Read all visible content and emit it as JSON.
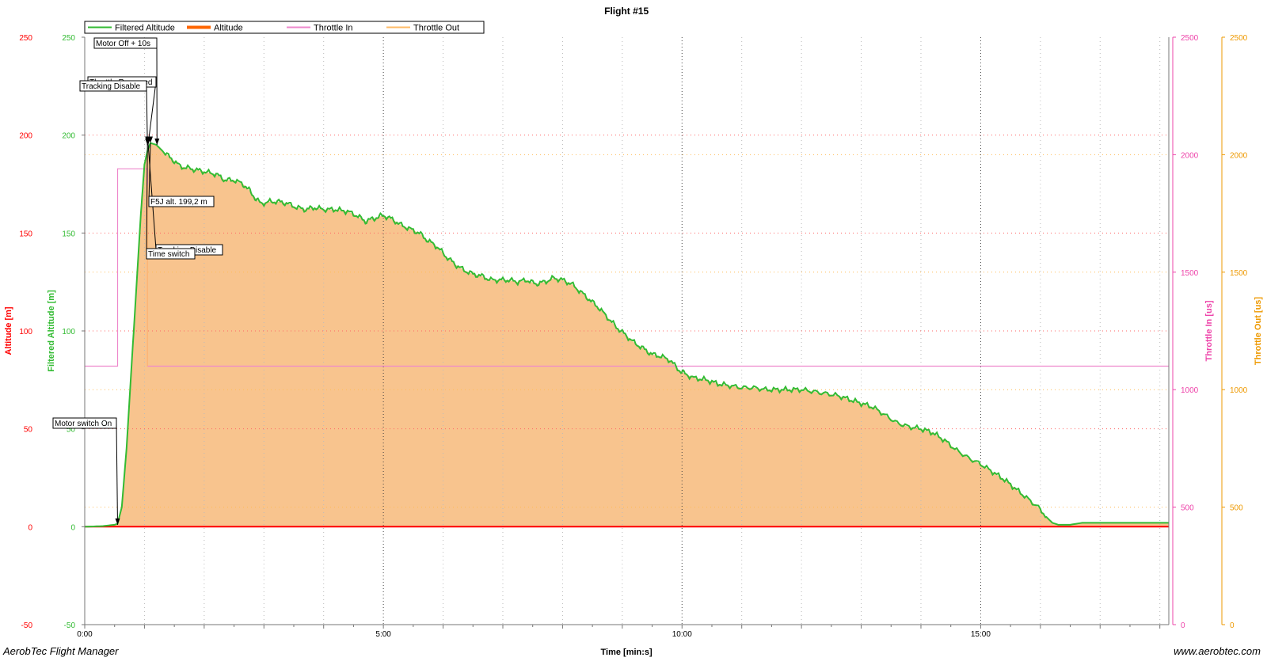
{
  "app": {
    "footer_left": "AerobTec Flight Manager",
    "footer_right": "www.aerobtec.com"
  },
  "chart_data": {
    "type": "line",
    "title": "Flight #15",
    "xlabel": "Time [min:s]",
    "x_unit": "minutes",
    "xlim": [
      0,
      18.15
    ],
    "x_ticks": [
      {
        "value": 0,
        "label": "0:00"
      },
      {
        "value": 5,
        "label": "5:00"
      },
      {
        "value": 10,
        "label": "10:00"
      },
      {
        "value": 15,
        "label": "15:00"
      }
    ],
    "axes": {
      "altitude": {
        "label": "Altitude [m]",
        "ylim": [
          -50,
          250
        ],
        "ticks": [
          -50,
          0,
          50,
          100,
          150,
          200,
          250
        ],
        "color": "#ff0000"
      },
      "filtered_altitude": {
        "label": "Filtered Altitude [m]",
        "ylim": [
          -50,
          250
        ],
        "ticks": [
          -50,
          0,
          50,
          100,
          150,
          200,
          250
        ],
        "color": "#33bb33"
      },
      "throttle_in": {
        "label": "Throttle In [us]",
        "ylim": [
          0,
          2500
        ],
        "ticks": [
          0,
          500,
          1000,
          1500,
          2000,
          2500
        ],
        "color": "#ee44aa"
      },
      "throttle_out": {
        "label": "Throttle Out [us]",
        "ylim": [
          0,
          2500
        ],
        "ticks": [
          0,
          500,
          1000,
          1500,
          2000,
          2500
        ],
        "color": "#ee9900"
      }
    },
    "grid": true,
    "legend_position": "top-left",
    "legend": [
      {
        "name": "Filtered Altitude",
        "color": "#33bb33"
      },
      {
        "name": "Altitude",
        "color": "#ff6600"
      },
      {
        "name": "Throttle In",
        "color": "#ee88cc"
      },
      {
        "name": "Throttle Out",
        "color": "#ffbb66"
      }
    ],
    "series": [
      {
        "name": "Filtered Altitude",
        "axis": "filtered_altitude",
        "color": "#33bb33",
        "fill": "#f8c48e",
        "points": [
          [
            0.0,
            0
          ],
          [
            0.3,
            0.3
          ],
          [
            0.5,
            1
          ],
          [
            0.55,
            1.5
          ],
          [
            0.62,
            10
          ],
          [
            0.7,
            40
          ],
          [
            0.78,
            80
          ],
          [
            0.86,
            120
          ],
          [
            0.94,
            160
          ],
          [
            1.0,
            185
          ],
          [
            1.05,
            192
          ],
          [
            1.1,
            196
          ],
          [
            1.2,
            195
          ],
          [
            1.3,
            192
          ],
          [
            1.45,
            188
          ],
          [
            1.6,
            184
          ],
          [
            1.75,
            183
          ],
          [
            1.9,
            182
          ],
          [
            2.05,
            181
          ],
          [
            2.2,
            180
          ],
          [
            2.35,
            177
          ],
          [
            2.5,
            177
          ],
          [
            2.65,
            175
          ],
          [
            2.75,
            172
          ],
          [
            2.85,
            168
          ],
          [
            2.95,
            165
          ],
          [
            3.1,
            166
          ],
          [
            3.25,
            166
          ],
          [
            3.4,
            165
          ],
          [
            3.55,
            163
          ],
          [
            3.7,
            162
          ],
          [
            3.85,
            163
          ],
          [
            4.0,
            162
          ],
          [
            4.2,
            162
          ],
          [
            4.4,
            161
          ],
          [
            4.55,
            159
          ],
          [
            4.7,
            156
          ],
          [
            4.8,
            157
          ],
          [
            4.9,
            158
          ],
          [
            5.0,
            159
          ],
          [
            5.15,
            157
          ],
          [
            5.3,
            154
          ],
          [
            5.45,
            152
          ],
          [
            5.6,
            150
          ],
          [
            5.75,
            146
          ],
          [
            5.9,
            143
          ],
          [
            6.05,
            138
          ],
          [
            6.2,
            134
          ],
          [
            6.35,
            131
          ],
          [
            6.5,
            129
          ],
          [
            6.65,
            128
          ],
          [
            6.8,
            126
          ],
          [
            6.95,
            126
          ],
          [
            7.1,
            126
          ],
          [
            7.25,
            125
          ],
          [
            7.4,
            126
          ],
          [
            7.55,
            124
          ],
          [
            7.7,
            125
          ],
          [
            7.85,
            127
          ],
          [
            8.0,
            126
          ],
          [
            8.15,
            124
          ],
          [
            8.3,
            120
          ],
          [
            8.45,
            116
          ],
          [
            8.6,
            112
          ],
          [
            8.75,
            107
          ],
          [
            8.9,
            102
          ],
          [
            9.05,
            98
          ],
          [
            9.2,
            94
          ],
          [
            9.35,
            91
          ],
          [
            9.5,
            88
          ],
          [
            9.65,
            87
          ],
          [
            9.8,
            85
          ],
          [
            9.95,
            80
          ],
          [
            10.05,
            78
          ],
          [
            10.2,
            76
          ],
          [
            10.4,
            75
          ],
          [
            10.6,
            73
          ],
          [
            10.8,
            72
          ],
          [
            11.0,
            71
          ],
          [
            11.2,
            71
          ],
          [
            11.4,
            70
          ],
          [
            11.6,
            70
          ],
          [
            11.8,
            70
          ],
          [
            12.0,
            70
          ],
          [
            12.2,
            69
          ],
          [
            12.4,
            68
          ],
          [
            12.6,
            67
          ],
          [
            12.8,
            65
          ],
          [
            13.0,
            63
          ],
          [
            13.2,
            61
          ],
          [
            13.4,
            57
          ],
          [
            13.6,
            53
          ],
          [
            13.8,
            51
          ],
          [
            14.0,
            50
          ],
          [
            14.2,
            48
          ],
          [
            14.4,
            44
          ],
          [
            14.6,
            39
          ],
          [
            14.8,
            35
          ],
          [
            15.0,
            32
          ],
          [
            15.2,
            28
          ],
          [
            15.4,
            24
          ],
          [
            15.6,
            19
          ],
          [
            15.8,
            14
          ],
          [
            16.0,
            9
          ],
          [
            16.1,
            5
          ],
          [
            16.2,
            2
          ],
          [
            16.3,
            1
          ],
          [
            16.5,
            1
          ],
          [
            16.7,
            2
          ],
          [
            17.0,
            2
          ],
          [
            17.5,
            2
          ],
          [
            18.0,
            2
          ],
          [
            18.15,
            2
          ]
        ]
      },
      {
        "name": "Altitude",
        "axis": "altitude",
        "color": "#ff0000",
        "points": [
          [
            0,
            0
          ],
          [
            18.15,
            0
          ]
        ]
      },
      {
        "name": "Throttle In",
        "axis": "throttle_in",
        "color": "#ee88cc",
        "points": [
          [
            0.0,
            1100
          ],
          [
            0.55,
            1100
          ],
          [
            0.55,
            1940
          ],
          [
            1.05,
            1940
          ],
          [
            1.05,
            1100
          ],
          [
            18.15,
            1100
          ]
        ]
      },
      {
        "name": "Throttle Out",
        "axis": "throttle_out",
        "color": "#ffbb66",
        "points": [
          [
            1.05,
            1100
          ],
          [
            1.05,
            1870
          ]
        ]
      }
    ],
    "annotations": [
      {
        "text": "Motor switch On",
        "x": 0.55,
        "y": 1
      },
      {
        "text": "Tracking Disable",
        "x": 1.05,
        "y": 195
      },
      {
        "text": "Throttle Reversed",
        "x": 1.06,
        "y": 195
      },
      {
        "text": "Motor Off + 10s",
        "x": 1.21,
        "y": 195
      },
      {
        "text": "F5J alt. 199,2 m",
        "x": 1.1,
        "y": 196
      },
      {
        "text": "Tracking Disable",
        "x": 1.06,
        "y": 196
      },
      {
        "text": "Time switch",
        "x": 1.05,
        "y": 196
      }
    ]
  }
}
